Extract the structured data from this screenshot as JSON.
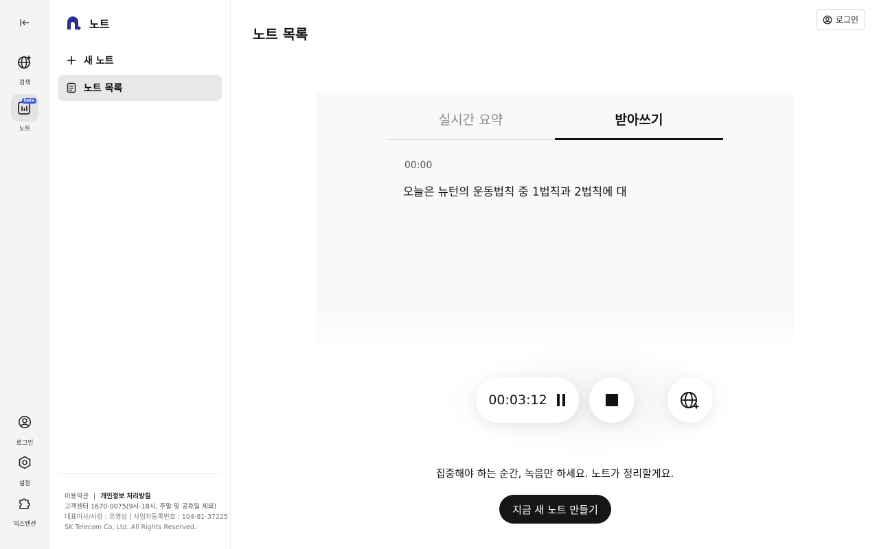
{
  "rail": {
    "search_label": "검색",
    "note_label": "노트",
    "beta_badge": "beta",
    "login_label": "로그인",
    "settings_label": "설정",
    "extension_label": "익스텐션"
  },
  "sidebar": {
    "brand_name": "노트",
    "new_note": "새 노트",
    "note_list": "노트 목록",
    "footer": {
      "terms": "이용약관",
      "separator": "|",
      "privacy": "개인정보 처리방침",
      "customer_center": "고객센터 1670-0075(9시-18시, 주말 및 공휴일 제외)",
      "ceo_reg": "대표이사/사장 : 유영상 | 사업자등록번호 : 104-81-37225",
      "copyright": "SK Telecom Co, Ltd. All Rights Reserved."
    }
  },
  "header": {
    "page_title": "노트 목록",
    "login_button": "로그인"
  },
  "recorder": {
    "tabs": [
      {
        "label": "실시간 요약",
        "active": false
      },
      {
        "label": "받아쓰기",
        "active": true
      }
    ],
    "timestamp": "00:00",
    "transcript": "오늘은 뉴턴의 운동법칙 중 1법칙과 2법칙에 대",
    "elapsed_timer": "00:03:12"
  },
  "main": {
    "tagline": "집중해야 하는 순간, 녹음만 하세요. 노트가 정리할게요.",
    "cta_button": "지금 새 노트 만들기"
  },
  "icons": {
    "collapse": "collapse-sidebar-icon",
    "search": "globe-sparkle-icon",
    "note": "note-voice-icon",
    "login": "user-circle-icon",
    "settings": "hexagon-gear-icon",
    "extension": "puzzle-icon",
    "brand": "brand-logo-icon",
    "plus": "plus-icon",
    "doc": "document-icon",
    "pause": "pause-icon",
    "stop": "stop-icon",
    "translate": "globe-sparkle-icon"
  },
  "colors": {
    "accent": "#161616",
    "brand": "#2b2f8f",
    "beta_badge": "#3b5bdb"
  }
}
